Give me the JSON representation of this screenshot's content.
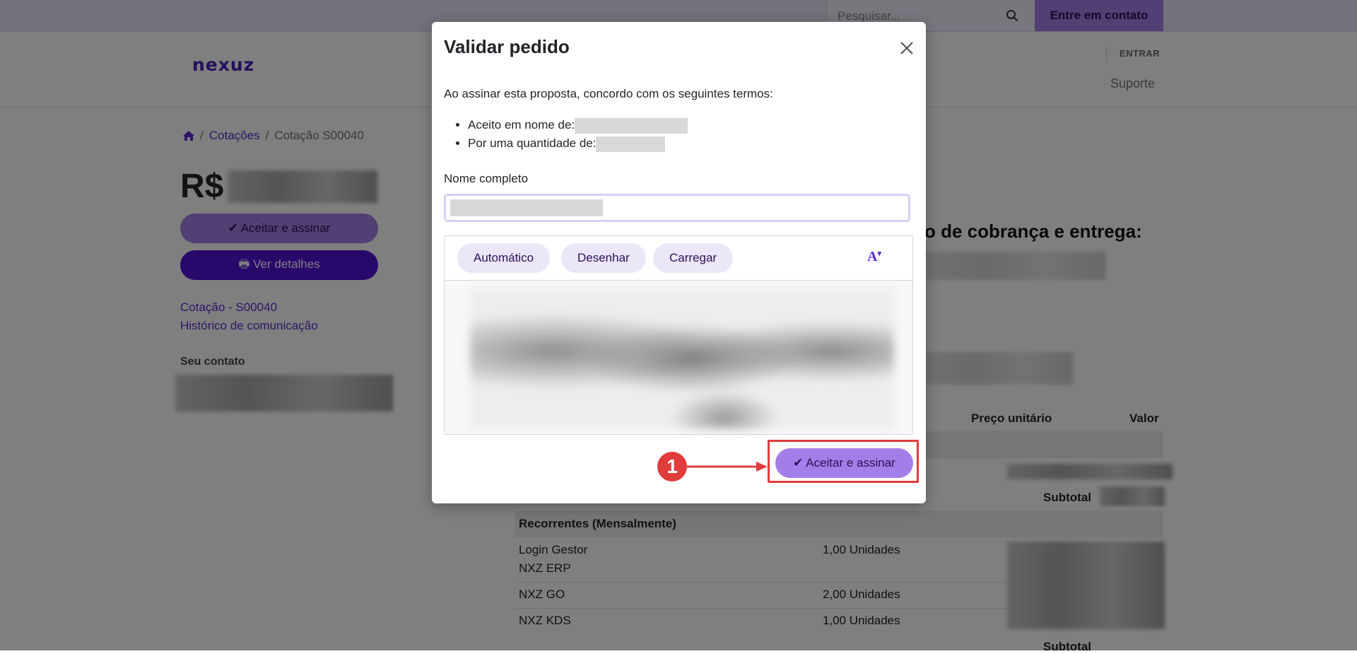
{
  "topbar": {
    "search_placeholder": "Pesquisar...",
    "contact_button": "Entre em contato"
  },
  "header": {
    "logo": "nexuz",
    "login": "ENTRAR",
    "support": "Suporte"
  },
  "breadcrumb": {
    "sep": "/",
    "quotes": "Cotações",
    "current": "Cotação S00040"
  },
  "sidebar": {
    "currency": "R$",
    "accept_button": "Aceitar e assinar",
    "details_button": "Ver detalhes",
    "quote_link": "Cotação - S00040",
    "history_link": "Histórico de comunicação",
    "contact_title": "Seu contato"
  },
  "content": {
    "billing_title": "o de cobrança e entrega:",
    "col_unit_price": "Preço unitário",
    "col_value": "Valor",
    "subtotal": "Subtotal",
    "recurring_group": "Recorrentes (Mensalmente)",
    "rows": [
      {
        "product": "Login Gestor",
        "qty": "1,00 Unidades"
      },
      {
        "product": "NXZ ERP",
        "qty": ""
      },
      {
        "product": "NXZ GO",
        "qty": "2,00 Unidades"
      },
      {
        "product": "NXZ KDS",
        "qty": "1,00 Unidades"
      }
    ]
  },
  "modal": {
    "title": "Validar pedido",
    "intro": "Ao assinar esta proposta, concordo com os seguintes termos:",
    "term_accepted_on_behalf": "Aceito em nome de:",
    "term_quantity": "Por uma quantidade de:",
    "name_label": "Nome completo",
    "tabs": [
      "Automático",
      "Desenhar",
      "Carregar"
    ],
    "font_button": "A",
    "accept_button": "Aceitar e assinar"
  },
  "annotation": {
    "step": "1",
    "color": "#e03c3c"
  },
  "colors": {
    "brand": "#5210d8",
    "accent_light": "#a47ee8",
    "topbar_bg": "#e9e2f8"
  }
}
